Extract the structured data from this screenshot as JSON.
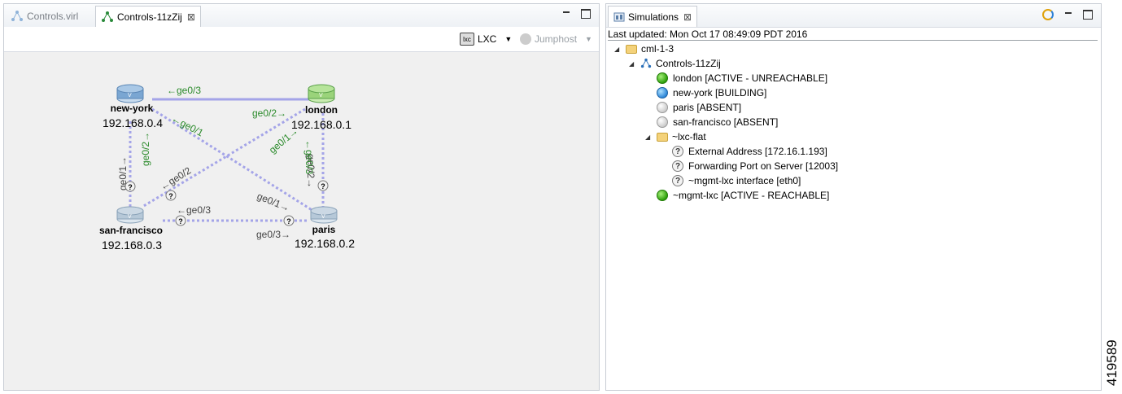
{
  "editor": {
    "tabs": [
      {
        "label": "Controls.virl",
        "active": false
      },
      {
        "label": "Controls-11zZij",
        "active": true
      }
    ],
    "toolbar": {
      "lxc_label": "LXC",
      "jumphost_label": "Jumphost"
    }
  },
  "topology": {
    "nodes": [
      {
        "name": "new-york",
        "ip": "192.168.0.4"
      },
      {
        "name": "london",
        "ip": "192.168.0.1"
      },
      {
        "name": "san-francisco",
        "ip": "192.168.0.3"
      },
      {
        "name": "paris",
        "ip": "192.168.0.2"
      }
    ],
    "link_labels": {
      "ny_london_top": "←ge0/3",
      "london_ny": "ge0/2→",
      "ny_ge01": "←ge0/1",
      "ny_ge02": "ge0/2→",
      "sf_ge01": "ge0/1→",
      "london_ge01": "ge0/1→",
      "london_ge02": "ge0/2→",
      "paris_ge03": "←ge0/3",
      "sf_ge02": "←ge0/2",
      "sf_ge03": "←ge0/3",
      "paris_ge01": "ge0/1→",
      "paris_ge03b": "ge0/3→"
    }
  },
  "simulations": {
    "tab_label": "Simulations",
    "last_updated": "Last updated: Mon Oct 17 08:49:09 PDT 2016",
    "tree": {
      "root": "cml-1-3",
      "sim": "Controls-11zZij",
      "nodes": [
        {
          "label": "london  [ACTIVE - UNREACHABLE]",
          "status": "green"
        },
        {
          "label": "new-york  [BUILDING]",
          "status": "blue"
        },
        {
          "label": "paris  [ABSENT]",
          "status": "grey"
        },
        {
          "label": "san-francisco  [ABSENT]",
          "status": "grey"
        }
      ],
      "lxc_folder": "~lxc-flat",
      "lxc_items": [
        "External Address  [172.16.1.193]",
        "Forwarding Port on Server  [12003]",
        "~mgmt-lxc interface  [eth0]"
      ],
      "mgmt": {
        "label": "~mgmt-lxc  [ACTIVE - REACHABLE]",
        "status": "green"
      }
    }
  },
  "figure_id": "419589"
}
